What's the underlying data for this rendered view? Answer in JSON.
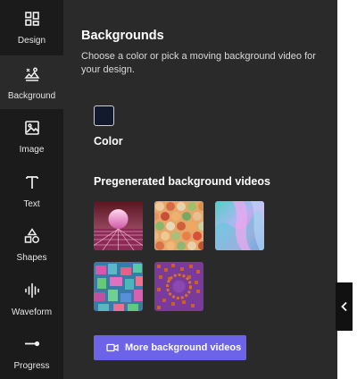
{
  "sidebar": {
    "items": [
      {
        "label": "Design",
        "icon": "grid-icon"
      },
      {
        "label": "Background",
        "icon": "background-icon"
      },
      {
        "label": "Image",
        "icon": "image-icon"
      },
      {
        "label": "Text",
        "icon": "text-icon"
      },
      {
        "label": "Shapes",
        "icon": "shapes-icon"
      },
      {
        "label": "Waveform",
        "icon": "waveform-icon"
      },
      {
        "label": "Progress",
        "icon": "progress-icon"
      }
    ],
    "active": "Background"
  },
  "panel": {
    "title": "Backgrounds",
    "description": "Choose a color or pick a moving background video for your design.",
    "color": {
      "label": "Color",
      "value": "#141a2e"
    },
    "videos": {
      "title": "Pregenerated background videos",
      "button_label": "More background videos",
      "button_icon": "video-camera-icon"
    }
  },
  "colors": {
    "accent": "#6c63e8",
    "sidebar_bg": "#1b1b1b",
    "panel_bg": "#2a2a2a"
  },
  "collapse_icon": "chevron-left-icon"
}
